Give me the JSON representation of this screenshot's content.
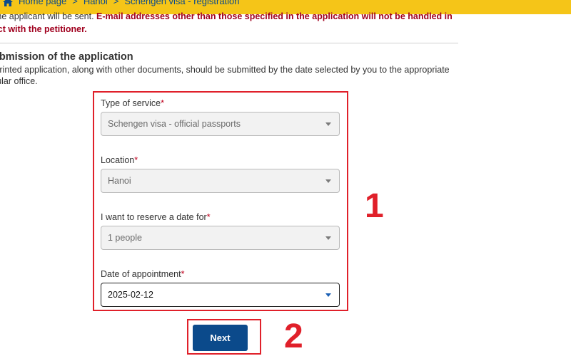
{
  "breadcrumb": {
    "items": [
      "Home page",
      "Hanoi",
      "Schengen visa - registration"
    ],
    "separator": ">"
  },
  "notice": {
    "line1_normal": "th the applicant will be sent. ",
    "line1_warning": "E-mail addresses other than those specified in the application will not be handled in",
    "line2_warning": "ntact with the petitioner."
  },
  "section": {
    "title": "ubmission of the application",
    "text_line1": "e printed application, along with other documents, should be submitted by the date selected by you to the appropriate",
    "text_line2": "nsular office."
  },
  "form": {
    "fields": [
      {
        "label": "Type of service",
        "required_mark": "*",
        "value": "Schengen visa - official passports"
      },
      {
        "label": "Location",
        "required_mark": "*",
        "value": "Hanoi"
      },
      {
        "label": "I want to reserve a date for",
        "required_mark": "*",
        "value": "1 people"
      },
      {
        "label": "Date of appointment",
        "required_mark": "*",
        "value": "2025-02-12"
      }
    ],
    "next_label": "Next"
  },
  "annotations": {
    "marker_1": "1",
    "marker_2": "2"
  },
  "colors": {
    "topbar": "#f5c518",
    "primary_button": "#0b4a8b",
    "highlight_box": "#e0202a",
    "warning_text": "#a0001e"
  }
}
